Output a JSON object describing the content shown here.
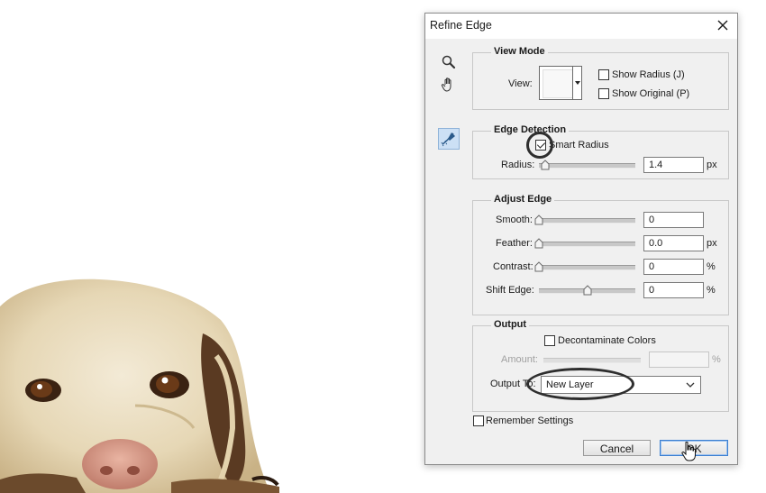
{
  "dialog": {
    "title": "Refine Edge",
    "view_mode": {
      "legend": "View Mode",
      "view_label": "View:",
      "show_radius": {
        "label": "Show Radius (J)",
        "checked": false
      },
      "show_original": {
        "label": "Show Original (P)",
        "checked": false
      }
    },
    "edge_detection": {
      "legend": "Edge Detection",
      "smart_radius": {
        "label": "Smart Radius",
        "checked": true
      },
      "radius": {
        "label": "Radius:",
        "value": "1.4",
        "unit": "px",
        "slider_fraction": 0.07
      }
    },
    "adjust_edge": {
      "legend": "Adjust Edge",
      "smooth": {
        "label": "Smooth:",
        "value": "0",
        "unit": "",
        "slider_fraction": 0.0
      },
      "feather": {
        "label": "Feather:",
        "value": "0.0",
        "unit": "px",
        "slider_fraction": 0.0
      },
      "contrast": {
        "label": "Contrast:",
        "value": "0",
        "unit": "%",
        "slider_fraction": 0.0
      },
      "shift_edge": {
        "label": "Shift Edge:",
        "value": "0",
        "unit": "%",
        "slider_fraction": 0.5
      }
    },
    "output": {
      "legend": "Output",
      "decontaminate": {
        "label": "Decontaminate Colors",
        "checked": false
      },
      "amount": {
        "label": "Amount:",
        "value": "",
        "unit": "%"
      },
      "output_to": {
        "label": "Output To:",
        "selected": "New Layer"
      }
    },
    "remember_settings": {
      "label": "Remember Settings",
      "checked": false
    },
    "cancel_label": "Cancel",
    "ok_label": "OK"
  },
  "colors": {
    "dialog_bg": "#f0f0f0",
    "active_tool_bg": "#cce0f5",
    "default_button_border": "#3c7fd1",
    "annotation_ring": "#2e2e2e"
  },
  "icons": [
    "zoom-icon",
    "hand-icon",
    "refine-radius-brush-icon",
    "close-icon",
    "chevron-down-icon",
    "mouse-pointer-icon"
  ]
}
